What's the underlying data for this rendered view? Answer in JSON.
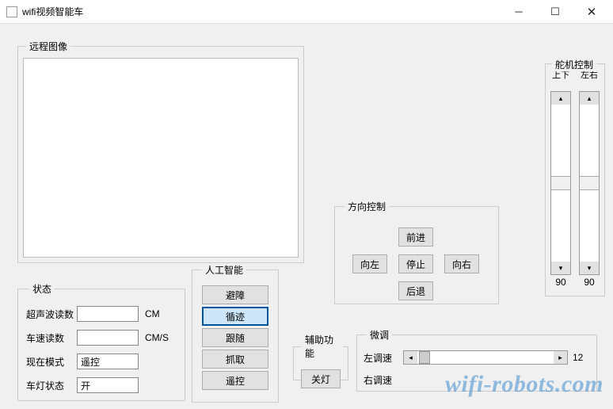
{
  "window": {
    "title": "wifi视频智能车"
  },
  "video": {
    "legend": "远程图像"
  },
  "status": {
    "legend": "状态",
    "rows": {
      "ultrasonic": {
        "label": "超声波读数",
        "value": "",
        "unit": "CM"
      },
      "speed": {
        "label": "车速读数",
        "value": "",
        "unit": "CM/S"
      },
      "mode": {
        "label": "现在模式",
        "value": "遥控",
        "unit": ""
      },
      "light": {
        "label": "车灯状态",
        "value": "开",
        "unit": ""
      }
    }
  },
  "ai": {
    "legend": "人工智能",
    "buttons": {
      "avoid": "避障",
      "trace": "循迹",
      "follow": "跟随",
      "grab": "抓取",
      "remote": "遥控"
    }
  },
  "aux": {
    "legend": "辅助功能",
    "light_off": "关灯"
  },
  "direction": {
    "legend": "方向控制",
    "forward": "前进",
    "left": "向左",
    "stop": "停止",
    "right": "向右",
    "back": "后退"
  },
  "finetune": {
    "legend": "微调",
    "left_label": "左调速",
    "right_label": "右调速",
    "left_value": "12",
    "right_value": ""
  },
  "servo": {
    "legend": "舵机控制",
    "col1_label": "上下",
    "col2_label": "左右",
    "col1_value": "90",
    "col2_value": "90"
  },
  "watermark": "wifi-robots.com"
}
